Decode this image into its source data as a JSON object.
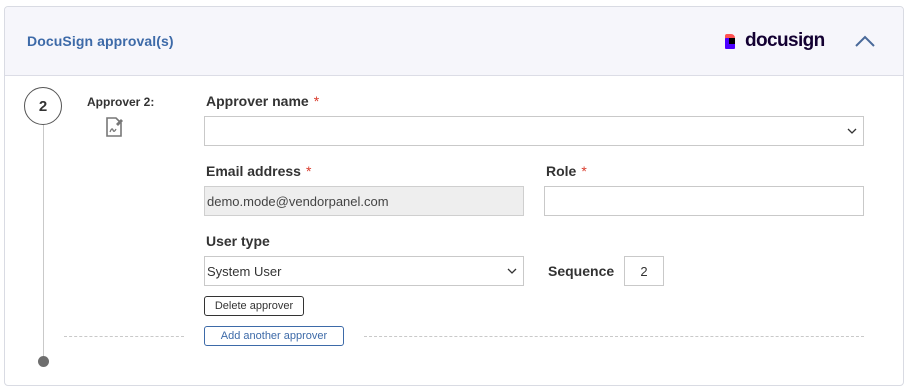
{
  "header": {
    "title": "DocuSign approval(s)",
    "brand_logo_text": "docusign",
    "collapse_icon": "chevron-up-icon"
  },
  "approver": {
    "step_number": "2",
    "label": "Approver 2:",
    "icon": "signature-document-icon"
  },
  "form": {
    "approver_name": {
      "label": "Approver name",
      "required": "*",
      "value": ""
    },
    "email": {
      "label": "Email address",
      "required": "*",
      "value": "demo.mode@vendorpanel.com"
    },
    "role": {
      "label": "Role",
      "required": "*",
      "value": ""
    },
    "user_type": {
      "label": "User type",
      "selected": "System User"
    },
    "sequence": {
      "label": "Sequence",
      "value": "2"
    }
  },
  "buttons": {
    "delete": "Delete approver",
    "add": "Add another approver"
  },
  "colors": {
    "title": "#3d6aa8",
    "header_bg": "#f6f6fb",
    "required": "#d93a2b",
    "logo_red": "#ff5252",
    "logo_purple": "#4c00ff"
  }
}
